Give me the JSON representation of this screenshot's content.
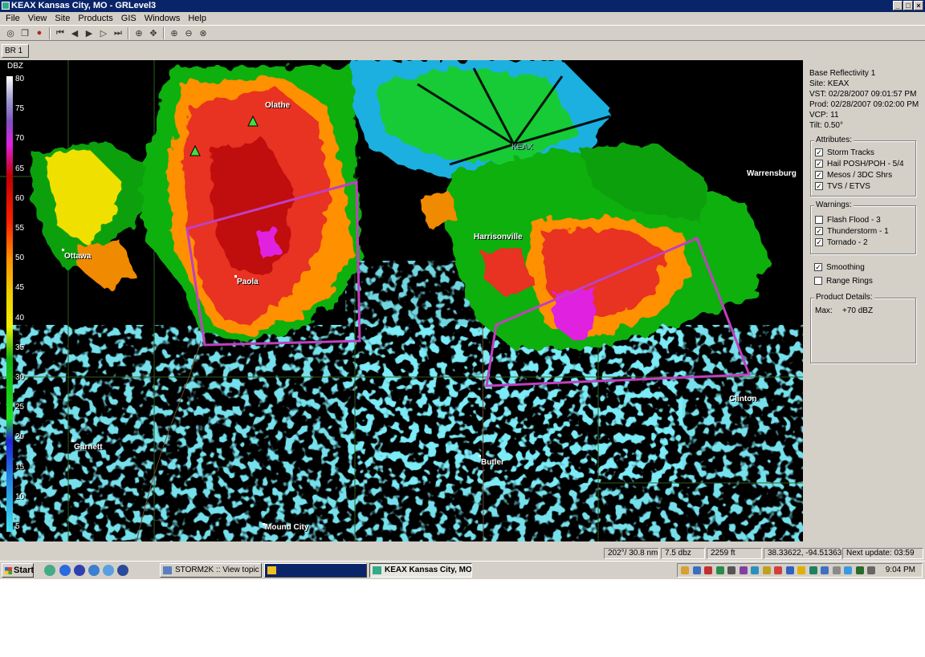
{
  "window": {
    "title": "KEAX Kansas City, MO - GRLevel3",
    "buttons": [
      "_",
      "□",
      "×"
    ]
  },
  "menu": [
    "File",
    "View",
    "Site",
    "Products",
    "GIS",
    "Windows",
    "Help"
  ],
  "toolbar": {
    "icons": [
      "open-icon",
      "copy-icon",
      "record-icon",
      "first-frame-icon",
      "prev-frame-icon",
      "play-icon",
      "next-frame-icon",
      "last-frame-icon",
      "zoom-icon",
      "pan-icon",
      "zoom-in-icon",
      "zoom-out-icon",
      "zoom-reset-icon"
    ]
  },
  "tab": {
    "label": "BR 1"
  },
  "legend": {
    "title": "DBZ",
    "ticks": [
      "80",
      "75",
      "70",
      "65",
      "60",
      "55",
      "50",
      "45",
      "40",
      "35",
      "30",
      "25",
      "20",
      "15",
      "10",
      "5"
    ]
  },
  "map": {
    "cities": {
      "olathe": "Olathe",
      "keax": "KEAX",
      "warrensburg": "Warrensburg",
      "harrisonville": "Harrisonville",
      "ottawa": "Ottawa",
      "paola": "Paola",
      "clinton": "Clinton",
      "garnett": "Garnett",
      "butler": "Butler",
      "mound_city": "Mound City"
    },
    "warning_color": "#c040c0"
  },
  "panel": {
    "product": "Base Reflectivity 1",
    "site": "Site:   KEAX",
    "vst": "VST:  02/28/2007  09:01:57 PM",
    "prod": "Prod: 02/28/2007  09:02:00 PM",
    "vcp": "VCP:  11",
    "tilt": "Tilt:   0.50°",
    "attributes_title": "Attributes:",
    "attributes": [
      {
        "label": "Storm Tracks",
        "checked": true
      },
      {
        "label": "Hail POSH/POH - 5/4",
        "checked": true
      },
      {
        "label": "Mesos / 3DC Shrs",
        "checked": true
      },
      {
        "label": "TVS / ETVS",
        "checked": true
      }
    ],
    "warnings_title": "Warnings:",
    "warnings": [
      {
        "label": "Flash Flood - 3",
        "checked": false
      },
      {
        "label": "Thunderstorm - 1",
        "checked": true
      },
      {
        "label": "Tornado - 2",
        "checked": true
      }
    ],
    "smoothing": {
      "label": "Smoothing",
      "checked": true
    },
    "range_rings": {
      "label": "Range Rings",
      "checked": false
    },
    "details_title": "Product Details:",
    "details_max_label": "Max:",
    "details_max_value": "+70 dBZ"
  },
  "status": {
    "azimuth": "202°/ 30.8 nm",
    "dbz": "7.5 dbz",
    "height": "2259 ft",
    "coords": "38.33622, -94.51363",
    "next_update": "Next update: 03:59"
  },
  "taskbar": {
    "start": "Start",
    "tasks": [
      "STORM2K :: View topic - ...",
      "",
      "KEAX Kansas City, MO ..."
    ],
    "clock": "9:04 PM"
  }
}
